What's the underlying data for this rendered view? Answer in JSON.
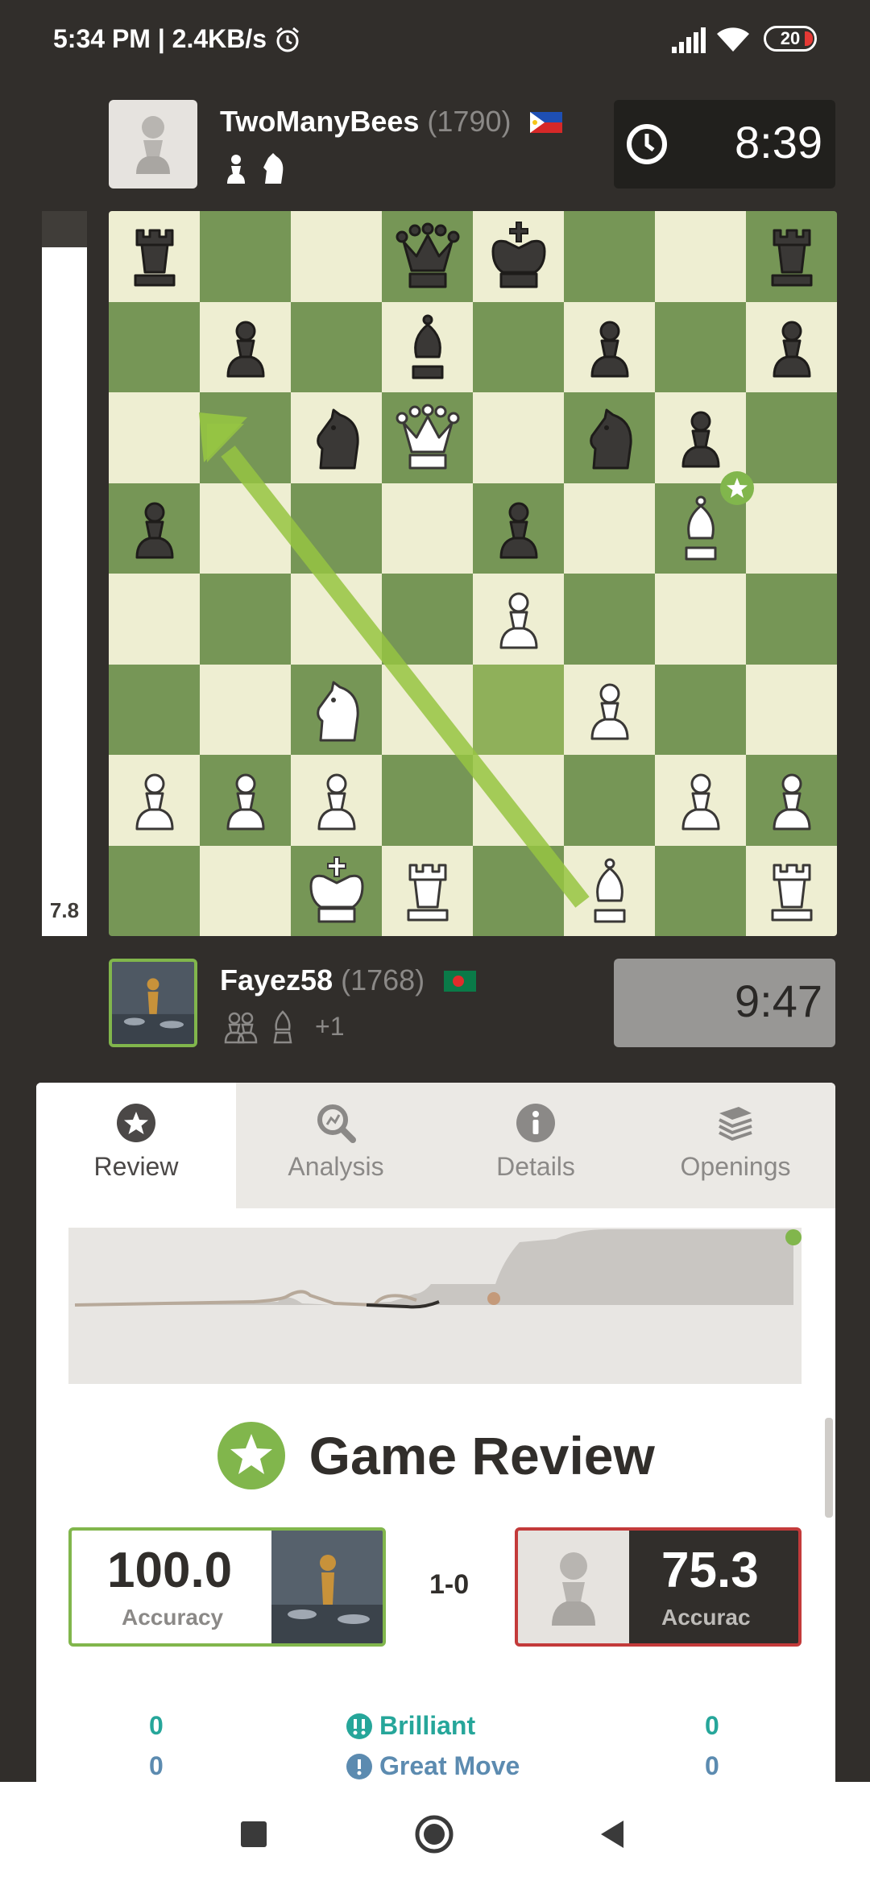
{
  "status_bar": {
    "text": "5:34 PM | 2.4KB/s",
    "battery": "20"
  },
  "top_player": {
    "name": "TwoManyBees",
    "rating": "(1790)",
    "clock": "8:39"
  },
  "bottom_player": {
    "name": "Fayez58",
    "rating": "(1768)",
    "captured_extra": "+1",
    "clock": "9:47"
  },
  "eval": {
    "label": "7.8",
    "white_fraction": 0.95
  },
  "tabs": [
    {
      "label": "Review"
    },
    {
      "label": "Analysis"
    },
    {
      "label": "Details"
    },
    {
      "label": "Openings"
    }
  ],
  "review": {
    "title": "Game Review",
    "white_accuracy": "100.0",
    "black_accuracy": "75.3",
    "accuracy_label": "Accuracy",
    "black_accuracy_label": "Accurac",
    "result": "1-0",
    "stats": [
      {
        "left": "0",
        "label": "Brilliant",
        "right": "0"
      },
      {
        "left": "0",
        "label": "Great Move",
        "right": "0"
      }
    ]
  },
  "colors": {
    "board_light": "#eeeed2",
    "board_dark": "#769656",
    "accent_green": "#81b64c",
    "black_card_border": "#c33a3a"
  }
}
